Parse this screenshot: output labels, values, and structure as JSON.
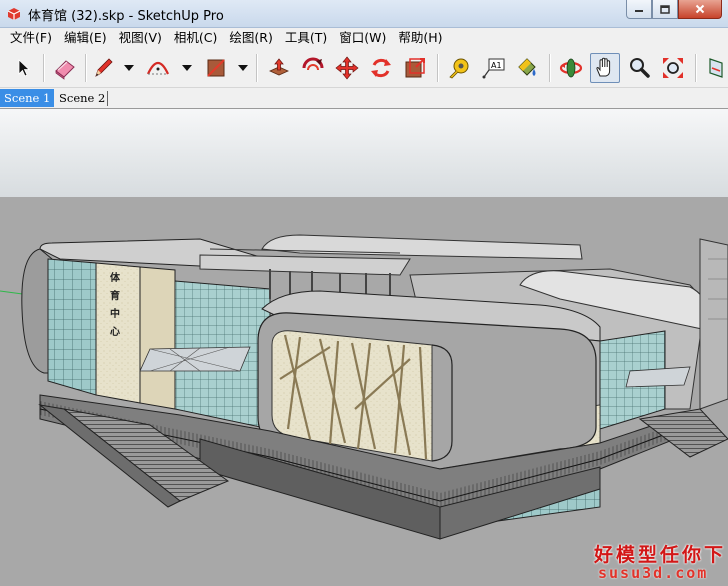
{
  "window": {
    "title": "体育馆 (32).skp - SketchUp Pro",
    "close_color": "#c7432b"
  },
  "menu": {
    "items": [
      {
        "label": "文件(F)"
      },
      {
        "label": "编辑(E)"
      },
      {
        "label": "视图(V)"
      },
      {
        "label": "相机(C)"
      },
      {
        "label": "绘图(R)"
      },
      {
        "label": "工具(T)"
      },
      {
        "label": "窗口(W)"
      },
      {
        "label": "帮助(H)"
      }
    ]
  },
  "toolbar": {
    "tools": [
      {
        "icon": "select-arrow-icon"
      },
      {
        "icon": "eraser-icon"
      },
      {
        "icon": "pencil-line-icon"
      },
      {
        "icon": "arc-icon"
      },
      {
        "icon": "rectangle-icon"
      },
      {
        "icon": "push-pull-icon"
      },
      {
        "icon": "offset-icon"
      },
      {
        "icon": "move-icon"
      },
      {
        "icon": "rotate-icon"
      },
      {
        "icon": "scale-icon"
      },
      {
        "icon": "tape-measure-icon"
      },
      {
        "icon": "text-label-icon"
      },
      {
        "icon": "paint-bucket-icon"
      },
      {
        "icon": "orbit-icon"
      },
      {
        "icon": "pan-hand-icon"
      },
      {
        "icon": "zoom-icon"
      },
      {
        "icon": "zoom-extents-icon"
      },
      {
        "icon": "section-plane-icon"
      }
    ],
    "active_tool": "pan-hand-icon"
  },
  "scenes": {
    "tabs": [
      {
        "label": "Scene 1",
        "active": true
      },
      {
        "label": "Scene 2",
        "active": false
      }
    ],
    "active_color": "#3a8ee6"
  },
  "model": {
    "signage": [
      "体",
      "育",
      "中",
      "心"
    ]
  },
  "watermark": {
    "chinese": "好模型任你下",
    "url": "susu3d.com"
  }
}
